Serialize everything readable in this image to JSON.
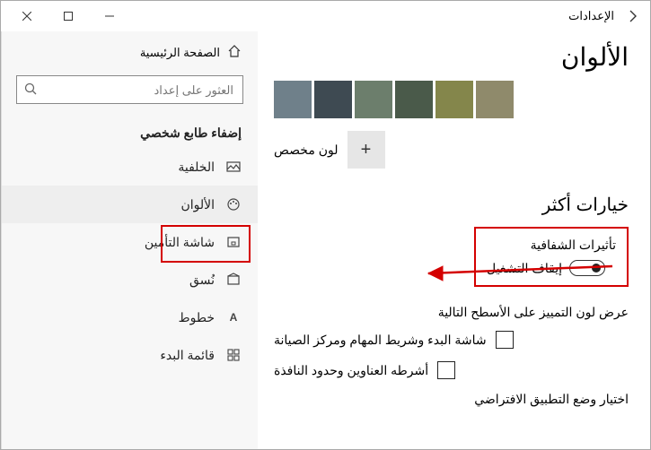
{
  "window": {
    "title": "الإعدادات"
  },
  "sidebar": {
    "home": "الصفحة الرئيسية",
    "search_placeholder": "العثور على إعداد",
    "section": "إضفاء طابع شخصي",
    "items": [
      {
        "label": "الخلفية"
      },
      {
        "label": "الألوان"
      },
      {
        "label": "شاشة التأمين"
      },
      {
        "label": "نُسق"
      },
      {
        "label": "خطوط"
      },
      {
        "label": "قائمة البدء"
      }
    ]
  },
  "main": {
    "heading": "الألوان",
    "swatches": [
      "#8f8a6b",
      "#84864b",
      "#4a5a4a",
      "#6c7e6c",
      "#3e4a52",
      "#6f808a"
    ],
    "custom_label": "لون مخصص",
    "more_options": "خيارات أكثر",
    "transparency_title": "تأثيرات الشفافية",
    "toggle_label": "إيقاف التشغيل",
    "accent_text": "عرض لون التمييز على الأسطح التالية",
    "cb1": "شاشة البدء وشريط المهام ومركز الصيانة",
    "cb2": "أشرطه العناوين وحدود النافذة",
    "default_mode": "اختيار وضع التطبيق الافتراضي"
  }
}
